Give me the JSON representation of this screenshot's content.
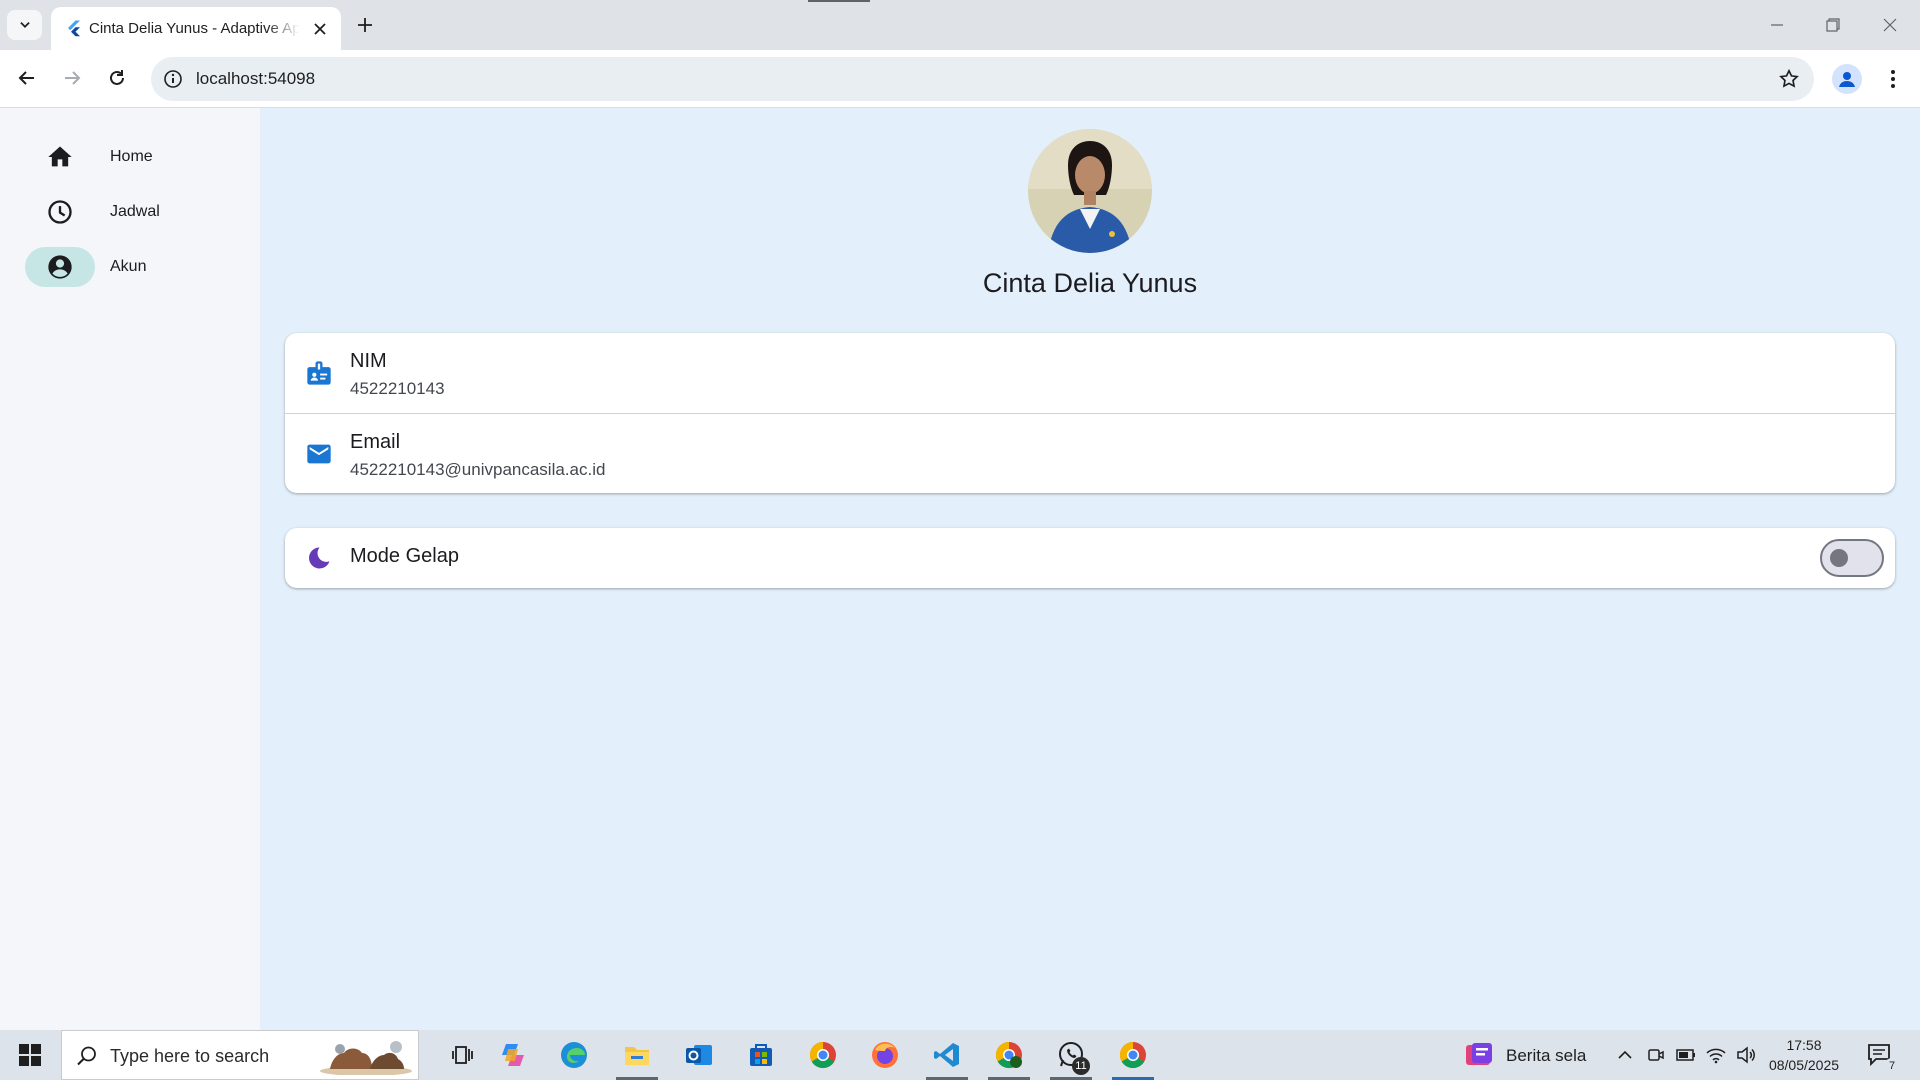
{
  "browser": {
    "tab_title": "Cinta Delia Yunus - Adaptive App",
    "url": "localhost:54098"
  },
  "rail": {
    "items": [
      {
        "label": "Home",
        "icon": "home-icon",
        "active": false
      },
      {
        "label": "Jadwal",
        "icon": "clock-icon",
        "active": false
      },
      {
        "label": "Akun",
        "icon": "account-circle-icon",
        "active": true
      }
    ]
  },
  "profile": {
    "name": "Cinta Delia Yunus",
    "info": [
      {
        "title": "NIM",
        "value": "4522210143",
        "icon": "badge-icon"
      },
      {
        "title": "Email",
        "value": "4522210143@univpancasila.ac.id",
        "icon": "email-icon"
      }
    ]
  },
  "settings": {
    "dark_mode_label": "Mode Gelap",
    "dark_mode_on": false
  },
  "taskbar": {
    "search_placeholder": "Type here to search",
    "news_text": "Berita sela",
    "time": "17:58",
    "date": "08/05/2025",
    "whatsapp_badge": "11",
    "notification_count": "7"
  },
  "colors": {
    "content_bg": "#e3f0fb",
    "rail_bg": "#f4f6fa",
    "active_pill": "#c6e6e6",
    "info_icon": "#1976d2",
    "moon_icon": "#673ab7"
  }
}
